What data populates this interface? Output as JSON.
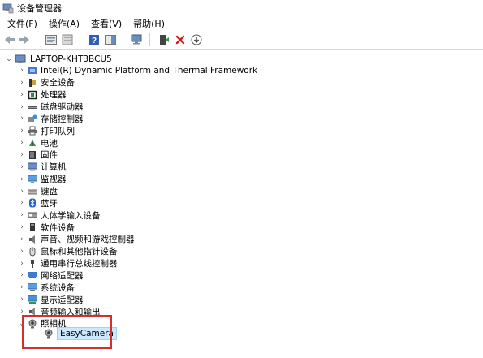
{
  "window": {
    "title": "设备管理器"
  },
  "menu": {
    "file": "文件(F)",
    "action": "操作(A)",
    "view": "查看(V)",
    "help": "帮助(H)"
  },
  "toolbar": {
    "icons": [
      "back-arrow-icon",
      "forward-arrow-icon",
      "properties-icon",
      "show-hidden-icon",
      "help-icon",
      "action-pane-icon",
      "monitor-scan-icon",
      "update-driver-icon",
      "uninstall-icon",
      "download-icon"
    ]
  },
  "tree": {
    "root": "LAPTOP-KHT3BCU5",
    "categories": [
      {
        "label": "Intel(R) Dynamic Platform and Thermal Framework",
        "icon": "thermal-framework-icon"
      },
      {
        "label": "安全设备",
        "icon": "security-device-icon"
      },
      {
        "label": "处理器",
        "icon": "processor-icon"
      },
      {
        "label": "磁盘驱动器",
        "icon": "disk-drive-icon"
      },
      {
        "label": "存储控制器",
        "icon": "storage-controller-icon"
      },
      {
        "label": "打印队列",
        "icon": "printer-icon"
      },
      {
        "label": "电池",
        "icon": "battery-icon"
      },
      {
        "label": "固件",
        "icon": "firmware-icon"
      },
      {
        "label": "计算机",
        "icon": "computer-icon"
      },
      {
        "label": "监视器",
        "icon": "monitor-icon"
      },
      {
        "label": "键盘",
        "icon": "keyboard-icon"
      },
      {
        "label": "蓝牙",
        "icon": "bluetooth-icon"
      },
      {
        "label": "人体学输入设备",
        "icon": "hid-icon"
      },
      {
        "label": "软件设备",
        "icon": "software-device-icon"
      },
      {
        "label": "声音、视频和游戏控制器",
        "icon": "sound-icon"
      },
      {
        "label": "鼠标和其他指针设备",
        "icon": "mouse-icon"
      },
      {
        "label": "通用串行总线控制器",
        "icon": "usb-icon"
      },
      {
        "label": "网络适配器",
        "icon": "network-adapter-icon"
      },
      {
        "label": "系统设备",
        "icon": "system-device-icon"
      },
      {
        "label": "显示适配器",
        "icon": "display-adapter-icon"
      },
      {
        "label": "音频输入和输出",
        "icon": "audio-io-icon"
      },
      {
        "label": "照相机",
        "icon": "camera-icon"
      }
    ],
    "camera_child": "EasyCamera"
  },
  "colors": {
    "highlight_border": "#d32f2f",
    "selection_bg": "#cce8ff"
  }
}
